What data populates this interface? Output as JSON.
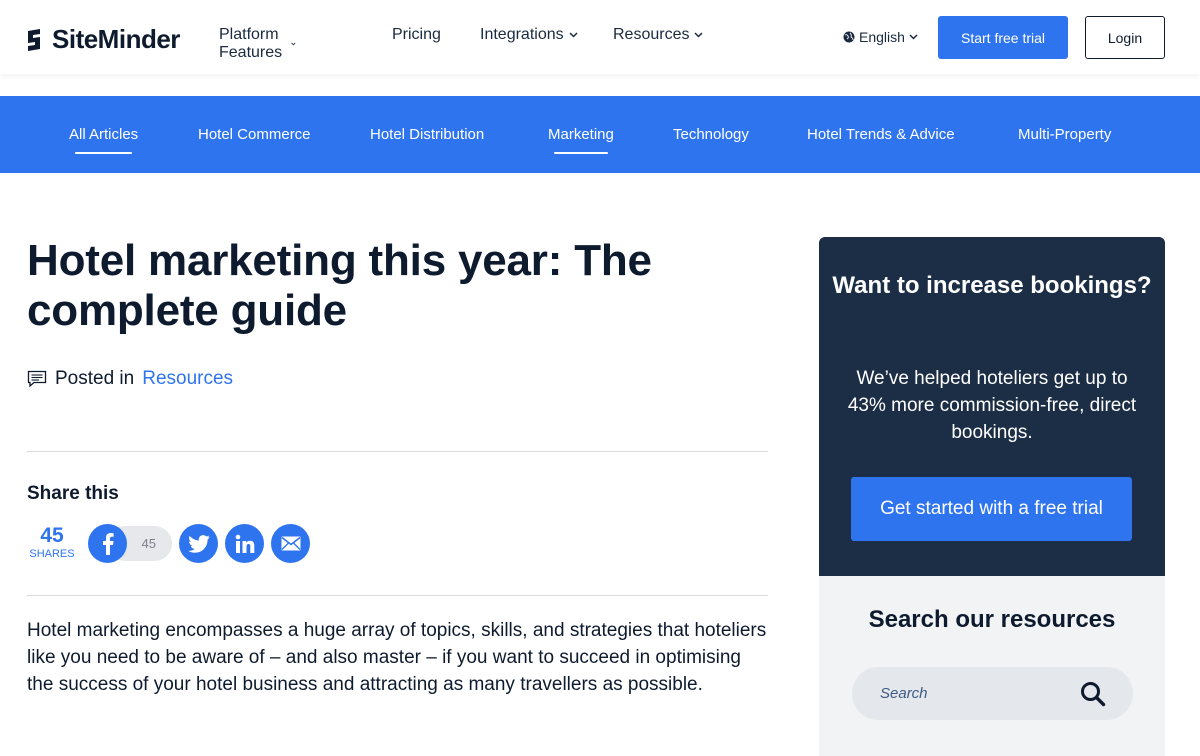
{
  "header": {
    "logo_text": "SiteMinder",
    "nav": [
      {
        "label": "Platform Features",
        "has_dropdown": true
      },
      {
        "label": "Pricing",
        "has_dropdown": false
      },
      {
        "label": "Integrations",
        "has_dropdown": true
      },
      {
        "label": "Resources",
        "has_dropdown": true
      }
    ],
    "language": "English",
    "trial_button": "Start free trial",
    "login_button": "Login"
  },
  "categories": [
    {
      "label": "All Articles",
      "active": true
    },
    {
      "label": "Hotel Commerce",
      "active": false
    },
    {
      "label": "Hotel Distribution",
      "active": false
    },
    {
      "label": "Marketing",
      "active": true
    },
    {
      "label": "Technology",
      "active": false
    },
    {
      "label": "Hotel Trends & Advice",
      "active": false
    },
    {
      "label": "Multi-Property",
      "active": false
    }
  ],
  "article": {
    "title": "Hotel marketing this year: The complete guide",
    "posted_prefix": "Posted in",
    "posted_category": "Resources",
    "share_title": "Share this",
    "share_count": "45",
    "share_label": "SHARES",
    "facebook_count": "45",
    "body": "Hotel marketing encompasses a huge array of topics, skills, and strategies that hoteliers like you need to be aware of – and also master – if you want to succeed in optimising the success of your hotel business and attracting as many travellers as possible."
  },
  "sidebar": {
    "promo_title": "Want to increase bookings?",
    "promo_text": "We’ve helped hoteliers get up to 43% more commission-free, direct bookings.",
    "promo_button": "Get started with a free trial",
    "search_title": "Search our resources",
    "search_placeholder": "Search"
  },
  "colors": {
    "brand_blue": "#2f74ef",
    "navy": "#1c2e45",
    "text": "#0e1b2e"
  }
}
